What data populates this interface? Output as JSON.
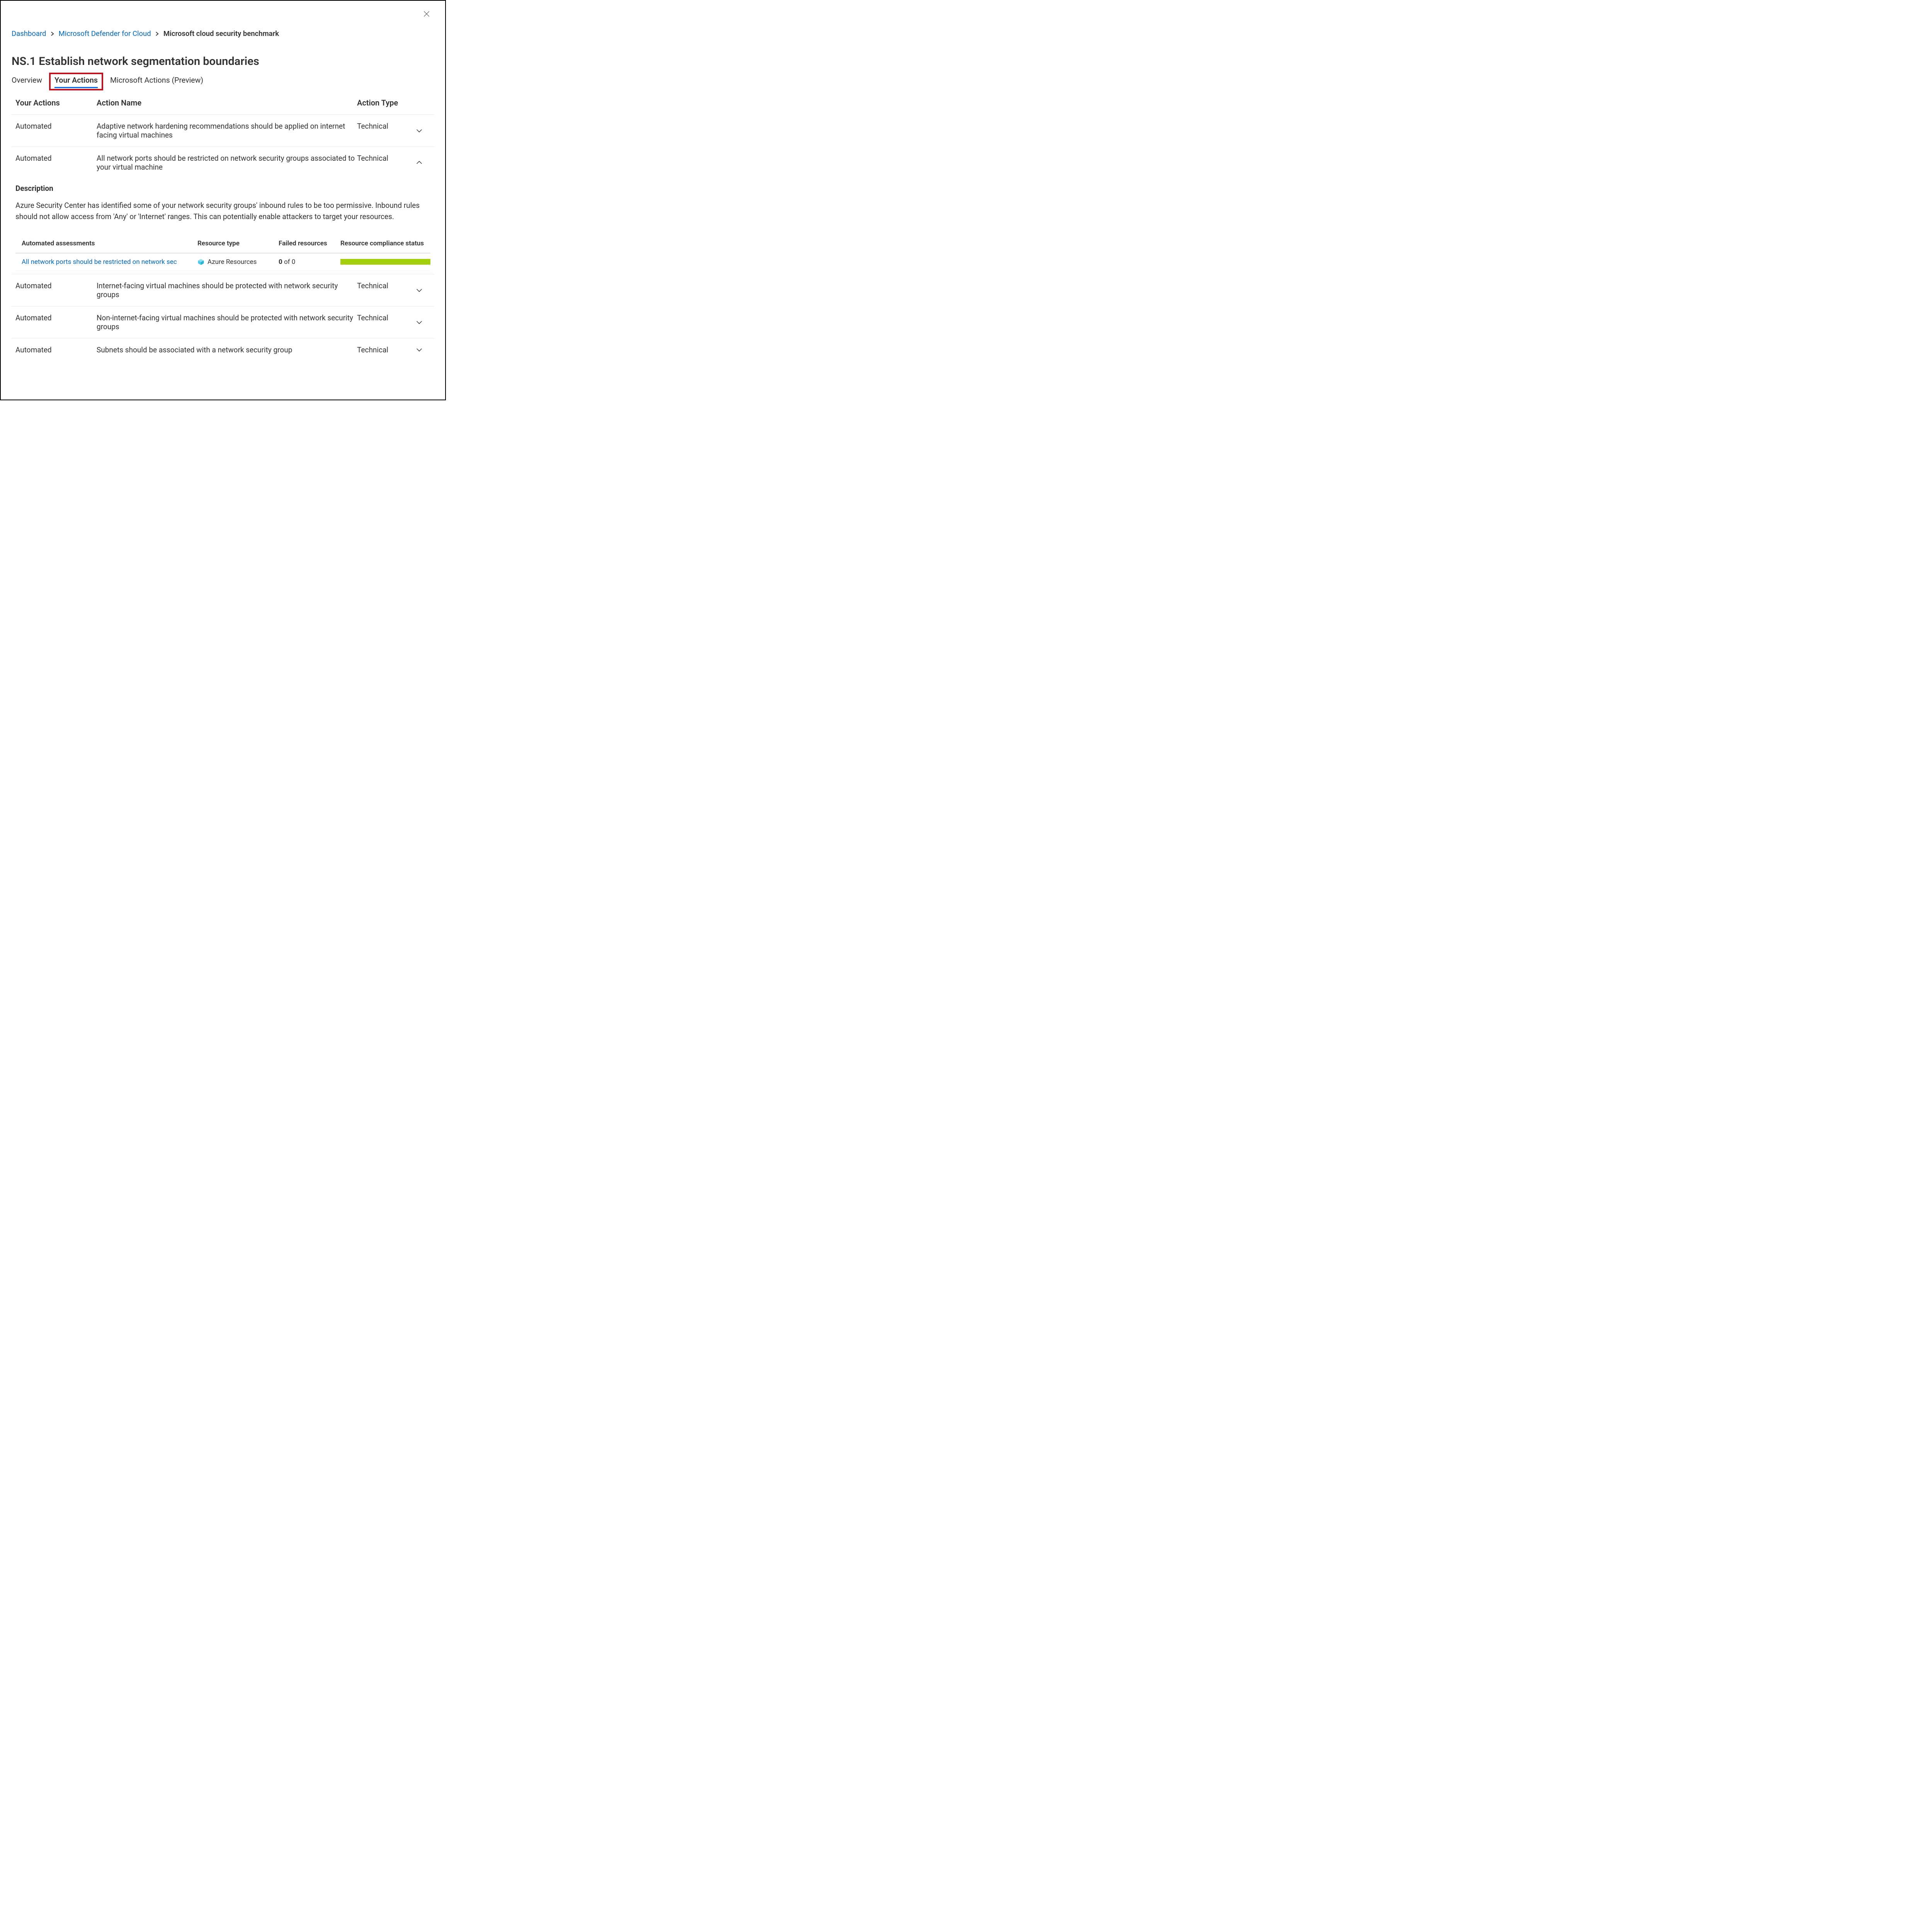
{
  "breadcrumb": {
    "items": [
      {
        "label": "Dashboard",
        "link": true
      },
      {
        "label": "Microsoft Defender for Cloud",
        "link": true
      },
      {
        "label": "Microsoft cloud security benchmark",
        "link": false
      }
    ]
  },
  "page_title": "NS.1 Establish network segmentation boundaries",
  "tabs": {
    "overview": "Overview",
    "your_actions": "Your Actions",
    "microsoft_actions": "Microsoft Actions (Preview)"
  },
  "columns": {
    "your_actions": "Your Actions",
    "action_name": "Action Name",
    "action_type": "Action Type"
  },
  "rows": [
    {
      "your_actions": "Automated",
      "name": "Adaptive network hardening recommendations should be applied on internet facing virtual machines",
      "type": "Technical",
      "expanded": false
    },
    {
      "your_actions": "Automated",
      "name": "All network ports should be restricted on network security groups associated to your virtual machine",
      "type": "Technical",
      "expanded": true
    },
    {
      "your_actions": "Automated",
      "name": "Internet-facing virtual machines should be protected with network security groups",
      "type": "Technical",
      "expanded": false
    },
    {
      "your_actions": "Automated",
      "name": "Non-internet-facing virtual machines should be protected with network security groups",
      "type": "Technical",
      "expanded": false
    },
    {
      "your_actions": "Automated",
      "name": "Subnets should be associated with a network security group",
      "type": "Technical",
      "expanded": false
    }
  ],
  "expanded": {
    "desc_heading": "Description",
    "desc_text": "Azure Security Center has identified some of your network security groups' inbound rules to be too permissive. Inbound rules should not allow access from 'Any' or 'Internet' ranges. This can potentially enable attackers to target your resources.",
    "assess_columns": {
      "assessments": "Automated assessments",
      "resource_type": "Resource type",
      "failed": "Failed resources",
      "compliance": "Resource compliance status"
    },
    "assess_row": {
      "link_text": "All network ports should be restricted on network sec",
      "resource_type": "Azure Resources",
      "failed_bold": "0",
      "failed_rest": " of 0"
    }
  },
  "colors": {
    "compliance_bar": "#a4cf0e"
  }
}
